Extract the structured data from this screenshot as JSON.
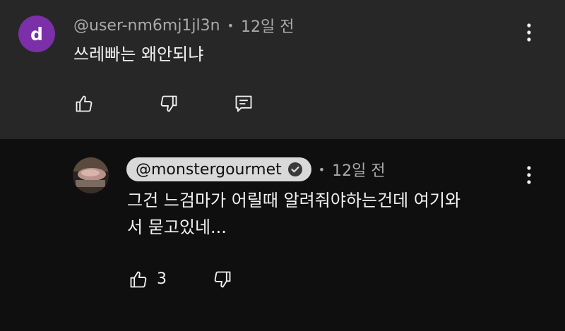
{
  "comments": [
    {
      "avatar_letter": "d",
      "avatar_color": "#7b2fa8",
      "username": "@user-nm6mj1jl3n",
      "time": "12일 전",
      "text": "쓰레빠는 왜안되냐",
      "icons": [
        "like-icon",
        "dislike-icon",
        "reply-icon",
        "more-vert-icon"
      ]
    },
    {
      "avatar": "profile-photo",
      "username": "@monstergourmet",
      "verified": true,
      "time": "12일 전",
      "text_line1": "그건 느검마가 어릴때 알려줘야하는건데 여기와",
      "text_line2": "서 묻고있네...",
      "like_count": "3",
      "icons": [
        "like-icon",
        "dislike-icon",
        "verified-check-icon",
        "more-vert-icon"
      ]
    }
  ],
  "colors": {
    "top_comment_bg": "#272727",
    "reply_bg": "#0f0f0f",
    "secondary_text": "#aaaaaa",
    "primary_text": "#f1f1f1",
    "channel_chip_bg": "#d9d9d9"
  }
}
